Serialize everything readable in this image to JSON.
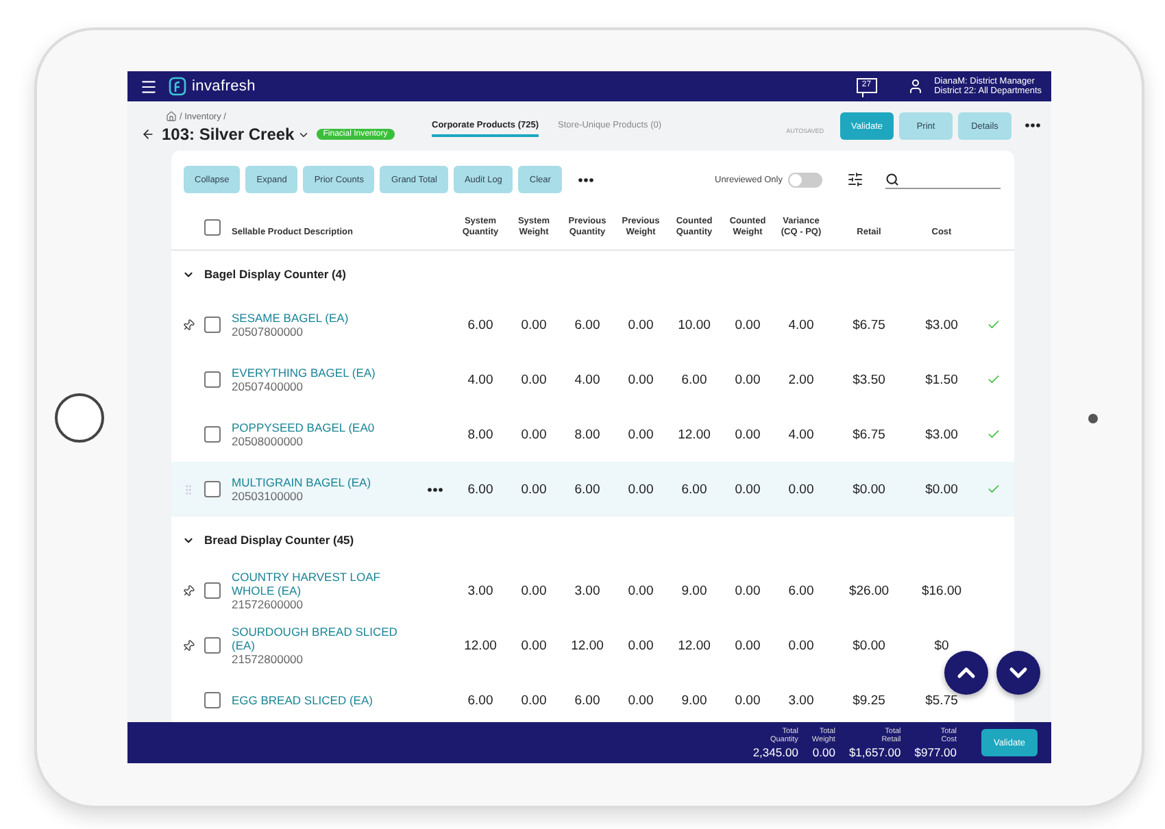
{
  "app": {
    "brand": "invafresh",
    "messages": "27",
    "user": {
      "name": "DianaM: District Manager",
      "scope": "District 22: All Departments"
    }
  },
  "page": {
    "breadcrumb": "/ Inventory /",
    "title": "103: Silver Creek",
    "badge": "Finacial Inventory",
    "autosave": "AUTOSAVED"
  },
  "tabs": [
    {
      "label": "Corporate Products (725)",
      "selected": true
    },
    {
      "label": "Store-Unique Products (0)",
      "selected": false
    }
  ],
  "actions": [
    {
      "label": "Validate",
      "primary": true
    },
    {
      "label": "Print",
      "primary": false
    },
    {
      "label": "Details",
      "primary": false
    }
  ],
  "toolbar": {
    "buttons": [
      "Collapse",
      "Expand",
      "Prior Counts",
      "Grand Total",
      "Audit Log",
      "Clear"
    ],
    "toggle": {
      "label": "Unreviewed Only",
      "on": false
    }
  },
  "table": {
    "all_checked": false,
    "columns": [
      "Sellable Product Description",
      "System Quantity",
      "System Weight",
      "Previous Quantity",
      "Previous Weight",
      "Counted Quantity",
      "Counted Weight",
      "Variance (CQ - PQ)",
      "Retail",
      "Cost"
    ],
    "groups": [
      {
        "name": "Bagel Display Counter (4)",
        "expanded": true,
        "rows": [
          {
            "name": "SESAME BAGEL (EA)",
            "code": "20507800000",
            "pinned": true,
            "checked": false,
            "highlighted": false,
            "reviewed": true,
            "values": [
              "6.00",
              "0.00",
              "6.00",
              "0.00",
              "10.00",
              "0.00",
              "4.00",
              "$6.75",
              "$3.00"
            ]
          },
          {
            "name": "EVERYTHING BAGEL (EA)",
            "code": "20507400000",
            "pinned": false,
            "checked": false,
            "highlighted": false,
            "reviewed": true,
            "values": [
              "4.00",
              "0.00",
              "4.00",
              "0.00",
              "6.00",
              "0.00",
              "2.00",
              "$3.50",
              "$1.50"
            ]
          },
          {
            "name": "POPPYSEED BAGEL (EA0",
            "code": "20508000000",
            "pinned": false,
            "checked": false,
            "highlighted": false,
            "reviewed": true,
            "values": [
              "8.00",
              "0.00",
              "8.00",
              "0.00",
              "12.00",
              "0.00",
              "4.00",
              "$6.75",
              "$3.00"
            ]
          },
          {
            "name": "MULTIGRAIN BAGEL (EA)",
            "code": "20503100000",
            "pinned": false,
            "checked": false,
            "highlighted": true,
            "reviewed": true,
            "values": [
              "6.00",
              "0.00",
              "6.00",
              "0.00",
              "6.00",
              "0.00",
              "0.00",
              "$0.00",
              "$0.00"
            ]
          }
        ]
      },
      {
        "name": "Bread Display Counter (45)",
        "expanded": true,
        "rows": [
          {
            "name": "COUNTRY HARVEST LOAF WHOLE (EA)",
            "code": "21572600000",
            "pinned": true,
            "checked": false,
            "highlighted": false,
            "reviewed": false,
            "values": [
              "3.00",
              "0.00",
              "3.00",
              "0.00",
              "9.00",
              "0.00",
              "6.00",
              "$26.00",
              "$16.00"
            ]
          },
          {
            "name": "SOURDOUGH BREAD SLICED (EA)",
            "code": "21572800000",
            "pinned": true,
            "checked": false,
            "highlighted": false,
            "reviewed": false,
            "values": [
              "12.00",
              "0.00",
              "12.00",
              "0.00",
              "12.00",
              "0.00",
              "0.00",
              "$0.00",
              "$0"
            ]
          },
          {
            "name": "EGG BREAD SLICED (EA)",
            "pinned": false,
            "checked": false,
            "highlighted": false,
            "reviewed": false,
            "values": [
              "6.00",
              "0.00",
              "6.00",
              "0.00",
              "9.00",
              "0.00",
              "3.00",
              "$9.25",
              "$5.75"
            ]
          }
        ]
      }
    ]
  },
  "footer": {
    "totals": [
      {
        "label": "Total Quantity",
        "value": "2,345.00"
      },
      {
        "label": "Total Weight",
        "value": "0.00"
      },
      {
        "label": "Total Retail",
        "value": "$1,657.00"
      },
      {
        "label": "Total Cost",
        "value": "$977.00"
      }
    ],
    "button": "Validate"
  }
}
